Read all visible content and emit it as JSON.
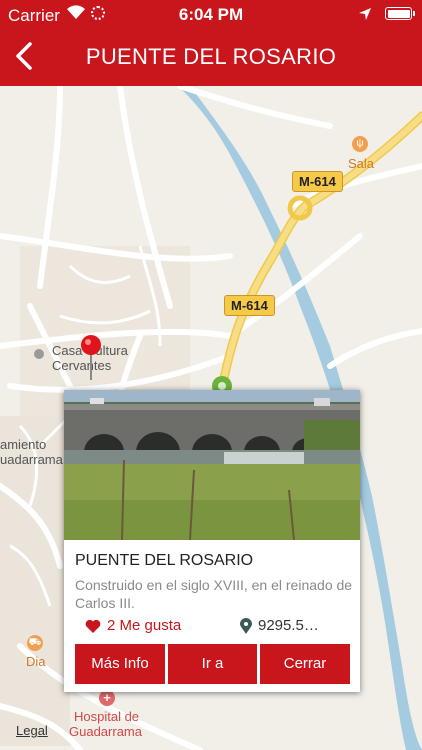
{
  "status_bar": {
    "carrier": "Carrier",
    "time": "6:04 PM"
  },
  "header": {
    "title": "PUENTE DEL ROSARIO"
  },
  "map": {
    "labels": {
      "sala": "Sala",
      "casa_cultura_1": "Casa  Cultura",
      "casa_cultura_2": "Cervantes",
      "ayuntamiento_1": "amiento",
      "ayuntamiento_2": "uadarrama",
      "dia": "Dia",
      "hospital_1": "Hospital de",
      "hospital_2": "Guadarrama",
      "road_1": "M-614",
      "road_2": "M-614",
      "legal": "Legal"
    }
  },
  "card": {
    "title": "PUENTE DEL ROSARIO",
    "description": "Construido en el siglo XVIII, en el reinado de Carlos III.",
    "likes": "2 Me gusta",
    "distance": "9295.5…",
    "buttons": {
      "info": "Más Info",
      "go": "Ir a",
      "close": "Cerrar"
    }
  },
  "colors": {
    "accent": "#c8161c",
    "river": "#a4cbe0"
  }
}
